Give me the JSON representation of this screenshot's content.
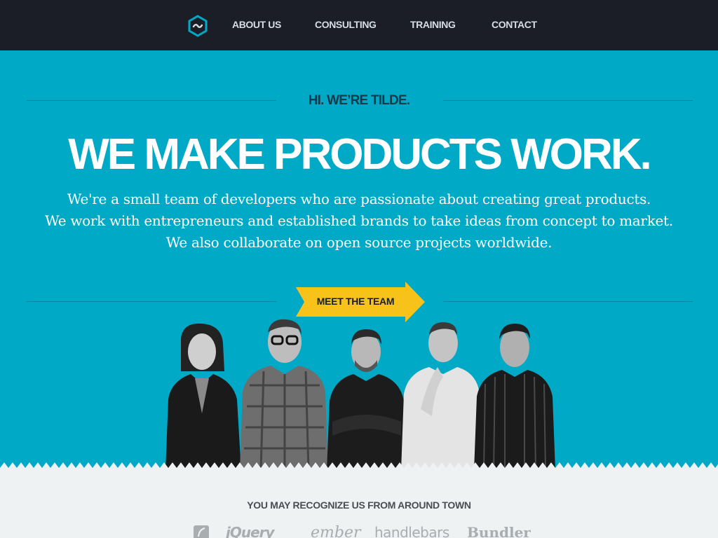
{
  "nav": {
    "logo_icon": "tilde-hexagon-icon",
    "links": [
      "ABOUT US",
      "CONSULTING",
      "TRAINING",
      "CONTACT"
    ]
  },
  "hero": {
    "intro": "HI. WE’RE TILDE.",
    "headline": "WE MAKE PRODUCTS WORK.",
    "description": [
      "We're a small team of developers who are passionate about creating great products.",
      "We work with entrepreneurs and established brands to take ideas from concept to market.",
      "We also collaborate on open source projects worldwide."
    ],
    "cta_label": "MEET THE TEAM"
  },
  "lower": {
    "heading": "YOU MAY RECOGNIZE US FROM AROUND TOWN",
    "logos": [
      "jQuery",
      "ember",
      "handlebars",
      "Bundler"
    ]
  },
  "colors": {
    "nav_bg": "#1b1e26",
    "hero_bg": "#00a9c6",
    "cta_yellow": "#f7c21a",
    "lower_bg": "#eef2f2"
  }
}
